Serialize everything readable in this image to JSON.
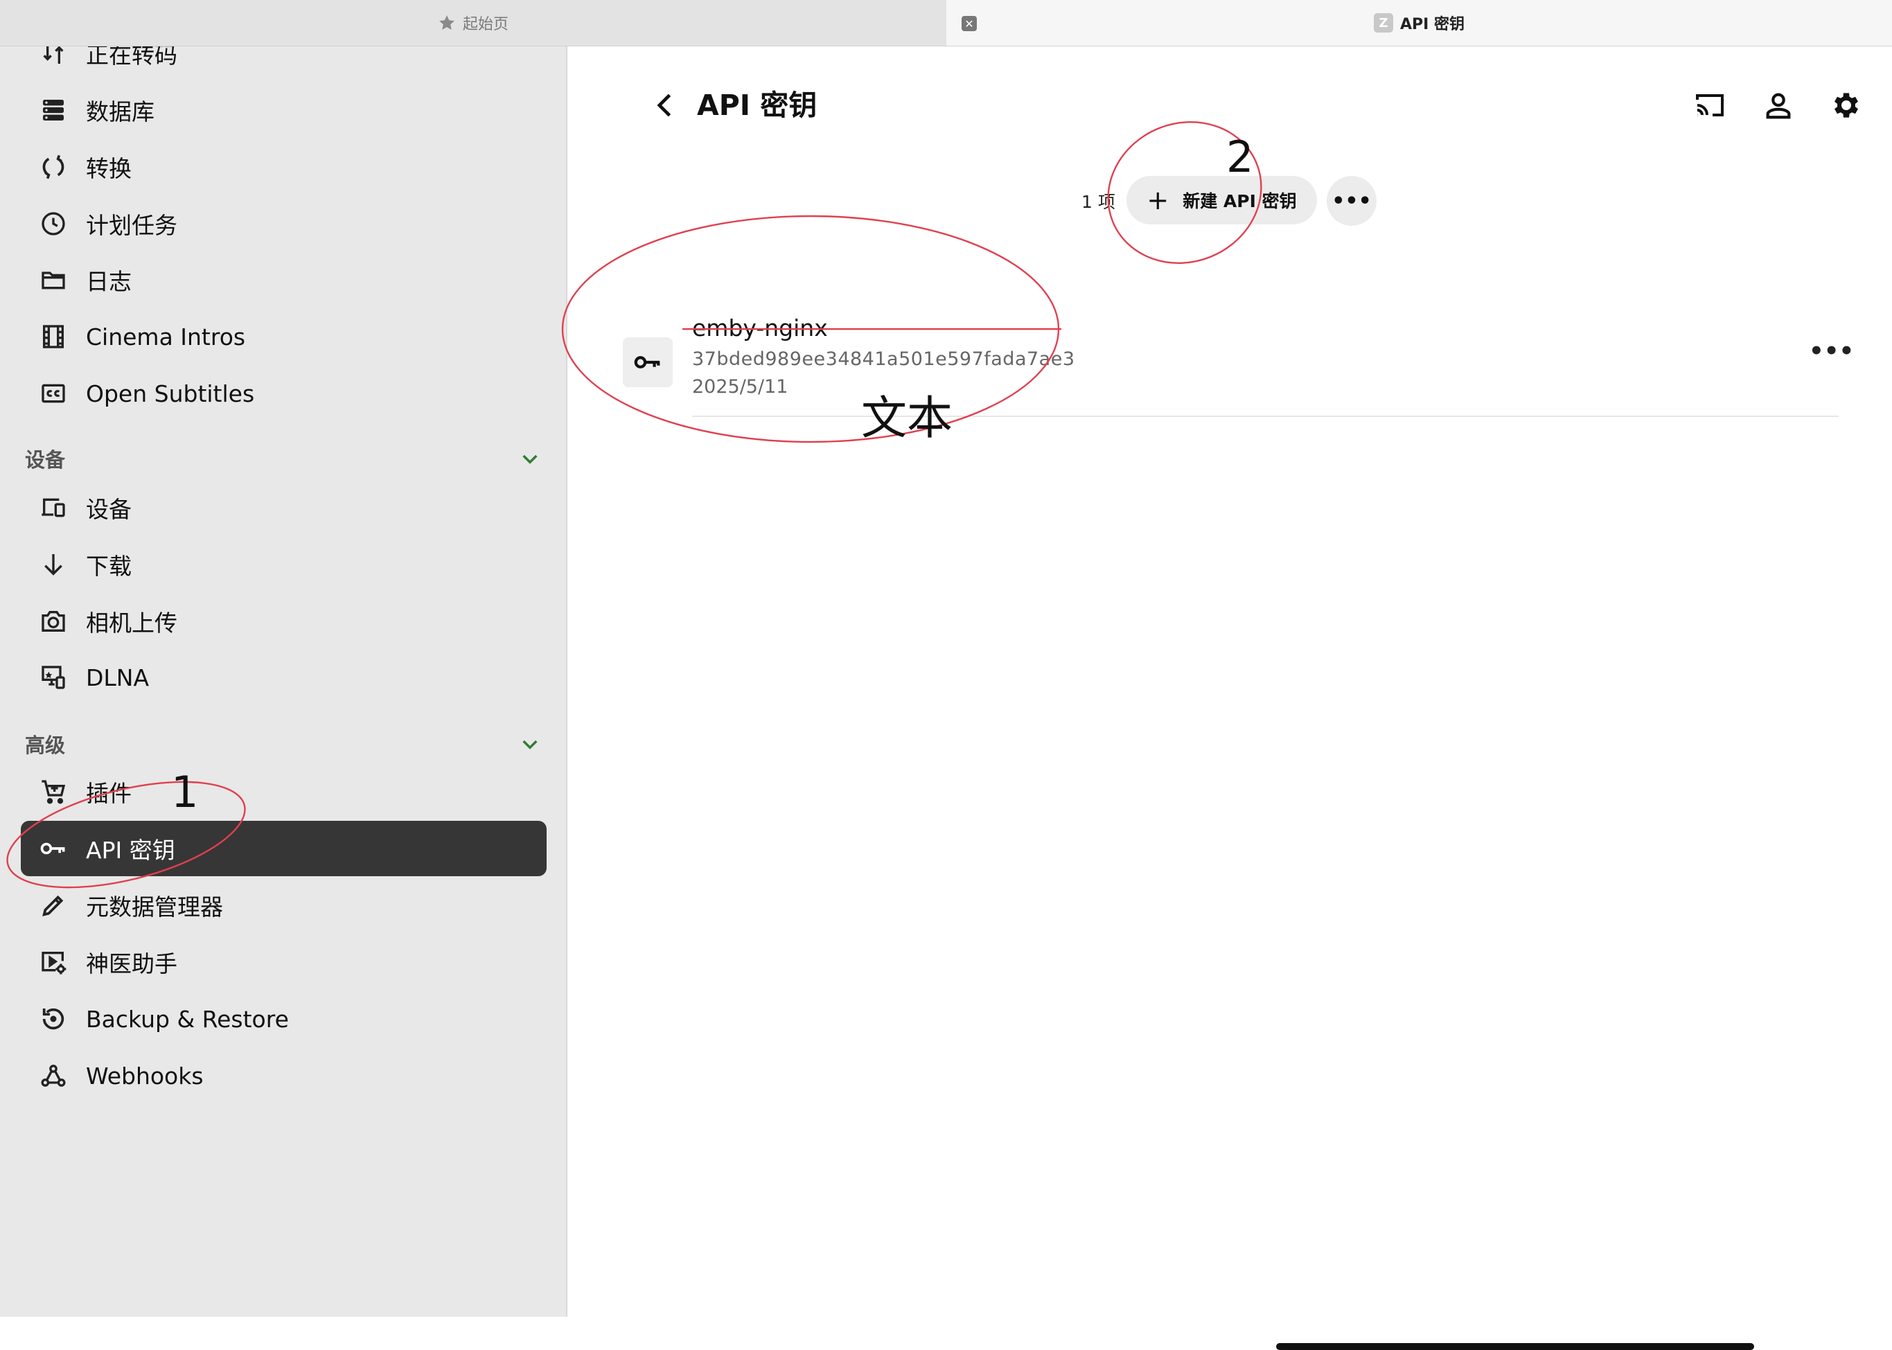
{
  "tabs": [
    {
      "label": "起始页",
      "icon": "star-icon",
      "active": false
    },
    {
      "label": "API 密钥",
      "icon": "favicon-z",
      "favicon_letter": "Z",
      "active": true
    }
  ],
  "tab_close_glyph": "✕",
  "sidebar": {
    "items_top": [
      {
        "label": "正在转码",
        "icon": "transcode-icon"
      },
      {
        "label": "数据库",
        "icon": "database-icon"
      },
      {
        "label": "转换",
        "icon": "convert-icon"
      },
      {
        "label": "计划任务",
        "icon": "clock-icon"
      },
      {
        "label": "日志",
        "icon": "folder-icon"
      },
      {
        "label": "Cinema Intros",
        "icon": "film-icon"
      },
      {
        "label": "Open Subtitles",
        "icon": "cc-icon"
      }
    ],
    "section_devices": {
      "title": "设备",
      "expanded": true
    },
    "items_devices": [
      {
        "label": "设备",
        "icon": "devices-icon"
      },
      {
        "label": "下载",
        "icon": "download-icon"
      },
      {
        "label": "相机上传",
        "icon": "camera-icon"
      },
      {
        "label": "DLNA",
        "icon": "dlna-icon"
      }
    ],
    "section_advanced": {
      "title": "高级",
      "expanded": true
    },
    "items_advanced": [
      {
        "label": "插件",
        "icon": "cart-icon"
      },
      {
        "label": "API 密钥",
        "icon": "key-icon",
        "selected": true
      },
      {
        "label": "元数据管理器",
        "icon": "pencil-icon"
      },
      {
        "label": "神医助手",
        "icon": "media-settings-icon"
      },
      {
        "label": "Backup & Restore",
        "icon": "restore-icon"
      },
      {
        "label": "Webhooks",
        "icon": "webhooks-icon"
      }
    ]
  },
  "header": {
    "title": "API 密钥",
    "icons": [
      "cast-icon",
      "user-icon",
      "gear-icon"
    ]
  },
  "toolbar": {
    "count": "1 项",
    "new_button_label": "新建 API 密钥",
    "more_glyph": "•••"
  },
  "api_keys": [
    {
      "name": "emby-nginx",
      "token": "37bded989ee34841a501e597fada7ae3",
      "date": "2025/5/11"
    }
  ],
  "row_more_glyph": "•••",
  "annotations": {
    "marker_1": "1",
    "marker_2": "2",
    "marker_text": "文本",
    "color": "#e0404f"
  },
  "colors": {
    "sidebar_bg": "#e8e8e8",
    "selected_bg": "#363636",
    "chevron": "#2e7d32",
    "annotation": "#e0404f"
  }
}
